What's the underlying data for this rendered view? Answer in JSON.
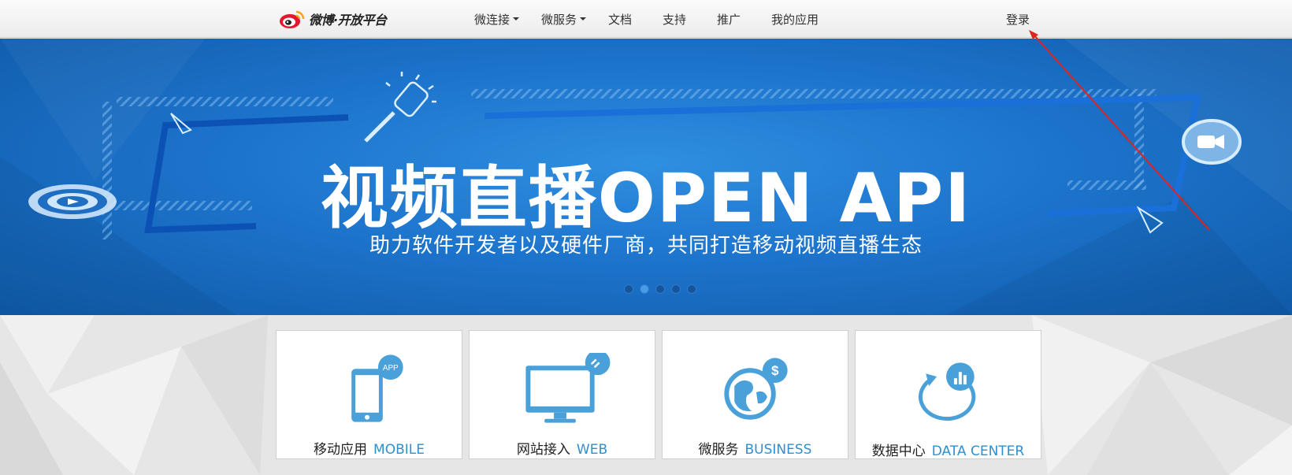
{
  "header": {
    "logo_text": "微博·开放平台",
    "nav": [
      {
        "label": "微连接",
        "dropdown": true
      },
      {
        "label": "微服务",
        "dropdown": true
      },
      {
        "label": "文档",
        "dropdown": false
      },
      {
        "label": "支持",
        "dropdown": false
      },
      {
        "label": "推广",
        "dropdown": false
      },
      {
        "label": "我的应用",
        "dropdown": false
      }
    ],
    "login_label": "登录"
  },
  "banner": {
    "headline": "视频直播OPEN API",
    "subline": "助力软件开发者以及硬件厂商，共同打造移动视频直播生态",
    "slide_count": 5,
    "active_slide": 2
  },
  "cards": [
    {
      "cn": "移动应用",
      "en": "MOBILE",
      "icon": "mobile-app-icon"
    },
    {
      "cn": "网站接入",
      "en": "WEB",
      "icon": "website-icon"
    },
    {
      "cn": "微服务",
      "en": "BUSINESS",
      "icon": "business-globe-icon"
    },
    {
      "cn": "数据中心",
      "en": "DATA CENTER",
      "icon": "data-center-icon"
    }
  ],
  "colors": {
    "accent_blue": "#2f8fcf",
    "banner_blue": "#1d74cc",
    "annotation_red": "#e0231f"
  }
}
